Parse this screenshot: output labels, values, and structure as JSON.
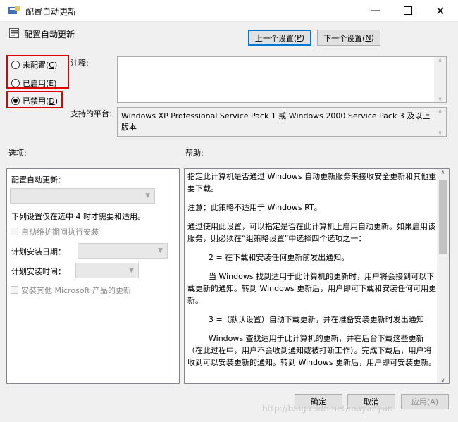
{
  "window": {
    "title": "配置自动更新",
    "header_title": "配置自动更新"
  },
  "nav": {
    "prev": "上一个设置(",
    "prev_key": "P",
    "next": "下一个设置(",
    "next_key": "N"
  },
  "state": {
    "not_configured": "未配置(",
    "not_configured_key": "C",
    "enabled": "已启用(",
    "enabled_key": "E",
    "disabled": "已禁用(",
    "disabled_key": "D",
    "selected": "disabled"
  },
  "labels": {
    "comment": "注释:",
    "supported_on": "支持的平台:",
    "options": "选项:",
    "help": "帮助:"
  },
  "supported_value": "Windows XP Professional Service Pack 1 或 Windows 2000 Service Pack 3 及以上版本",
  "options": {
    "configure_label": "配置自动更新：",
    "note": "下列设置仅在选中 4 时才需要和适用。",
    "maintenance": "自动维护期间执行安装",
    "install_day": "计划安装日期：",
    "install_time": "计划安装时间：",
    "other_products": "安装其他 Microsoft 产品的更新"
  },
  "help": [
    "指定此计算机是否通过 Windows 自动更新服务来接收安全更新和其他重要下载。",
    "注意：此策略不适用于 Windows RT。",
    "通过使用此设置，可以指定是否在此计算机上启用自动更新。如果启用该服务，则必须在“组策略设置”中选择四个选项之一：",
    "2 = 在下载和安装任何更新前发出通知。",
    "当 Windows 找到适用于此计算机的更新时，用户将会接到可以下载更新的通知。转到 Windows 更新后，用户即可下载和安装任何可用更新。",
    "3 =（默认设置）自动下载更新，并在准备安装更新时发出通知",
    "Windows 查找适用于此计算机的更新，并在后台下载这些更新（在此过程中，用户不会收到通知或被打断工作）。完成下载后，用户将收到可以安装更新的通知。转到 Windows 更新后，用户即可安装更新。"
  ],
  "buttons": {
    "ok": "确定",
    "cancel": "取消",
    "apply": "应用(A)"
  },
  "watermark": "http://blog.csdn.net/mayanyun"
}
